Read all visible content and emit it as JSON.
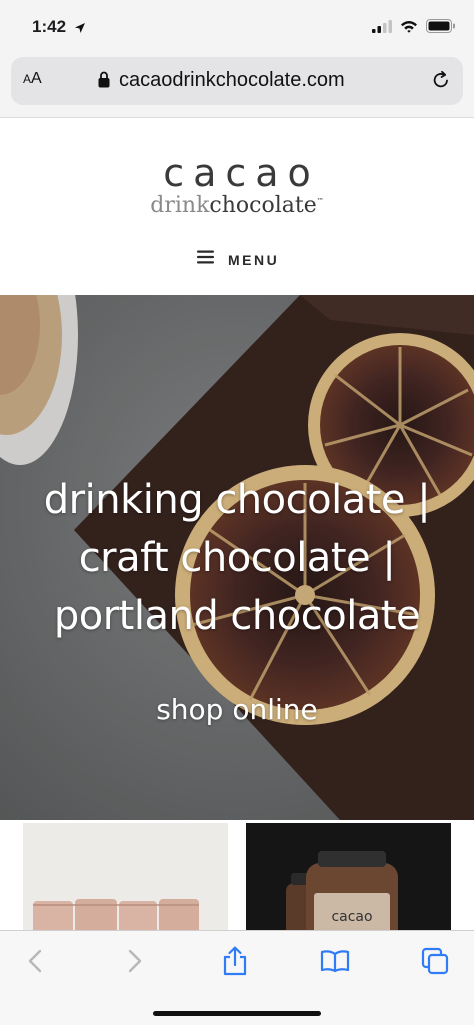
{
  "status_bar": {
    "time": "1:42",
    "location_icon": "location-arrow-icon",
    "signal_icon": "cellular-signal-icon",
    "wifi_icon": "wifi-icon",
    "battery_icon": "battery-icon"
  },
  "browser": {
    "text_size_label": "AA",
    "url": "cacaodrinkchocolate.com",
    "lock_icon": "lock-icon",
    "reload_icon": "reload-icon"
  },
  "site": {
    "logo_top": "cacao",
    "logo_bottom_light": "drink",
    "logo_bottom_dark": "chocolate",
    "logo_tm": "™",
    "menu_label": "MENU",
    "menu_icon": "hamburger-icon"
  },
  "hero": {
    "title": "drinking chocolate | craft chocolate | portland chocolate",
    "cta": "shop online"
  },
  "products": {
    "jar_label": "cacao"
  },
  "toolbar": {
    "back_icon": "back-chevron-icon",
    "forward_icon": "forward-chevron-icon",
    "share_icon": "share-icon",
    "bookmarks_icon": "bookmarks-icon",
    "tabs_icon": "tabs-icon"
  },
  "colors": {
    "ios_blue": "#2f7cf6",
    "disabled_gray": "#b8b8bc",
    "hero_gray": "#7d7f80",
    "chocolate": "#3b2620"
  }
}
